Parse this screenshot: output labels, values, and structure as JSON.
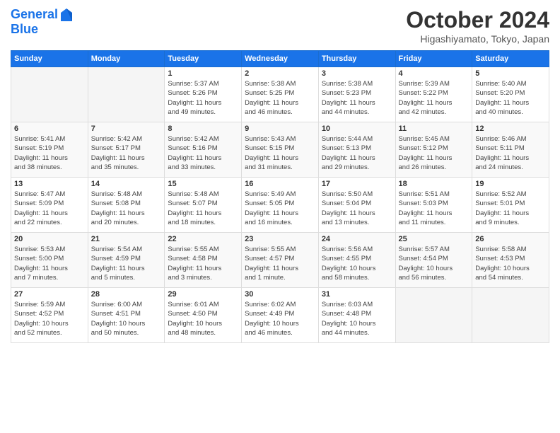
{
  "header": {
    "logo_line1": "General",
    "logo_line2": "Blue",
    "month": "October 2024",
    "location": "Higashiyamato, Tokyo, Japan"
  },
  "days_of_week": [
    "Sunday",
    "Monday",
    "Tuesday",
    "Wednesday",
    "Thursday",
    "Friday",
    "Saturday"
  ],
  "weeks": [
    [
      {
        "num": "",
        "detail": ""
      },
      {
        "num": "",
        "detail": ""
      },
      {
        "num": "1",
        "detail": "Sunrise: 5:37 AM\nSunset: 5:26 PM\nDaylight: 11 hours\nand 49 minutes."
      },
      {
        "num": "2",
        "detail": "Sunrise: 5:38 AM\nSunset: 5:25 PM\nDaylight: 11 hours\nand 46 minutes."
      },
      {
        "num": "3",
        "detail": "Sunrise: 5:38 AM\nSunset: 5:23 PM\nDaylight: 11 hours\nand 44 minutes."
      },
      {
        "num": "4",
        "detail": "Sunrise: 5:39 AM\nSunset: 5:22 PM\nDaylight: 11 hours\nand 42 minutes."
      },
      {
        "num": "5",
        "detail": "Sunrise: 5:40 AM\nSunset: 5:20 PM\nDaylight: 11 hours\nand 40 minutes."
      }
    ],
    [
      {
        "num": "6",
        "detail": "Sunrise: 5:41 AM\nSunset: 5:19 PM\nDaylight: 11 hours\nand 38 minutes."
      },
      {
        "num": "7",
        "detail": "Sunrise: 5:42 AM\nSunset: 5:17 PM\nDaylight: 11 hours\nand 35 minutes."
      },
      {
        "num": "8",
        "detail": "Sunrise: 5:42 AM\nSunset: 5:16 PM\nDaylight: 11 hours\nand 33 minutes."
      },
      {
        "num": "9",
        "detail": "Sunrise: 5:43 AM\nSunset: 5:15 PM\nDaylight: 11 hours\nand 31 minutes."
      },
      {
        "num": "10",
        "detail": "Sunrise: 5:44 AM\nSunset: 5:13 PM\nDaylight: 11 hours\nand 29 minutes."
      },
      {
        "num": "11",
        "detail": "Sunrise: 5:45 AM\nSunset: 5:12 PM\nDaylight: 11 hours\nand 26 minutes."
      },
      {
        "num": "12",
        "detail": "Sunrise: 5:46 AM\nSunset: 5:11 PM\nDaylight: 11 hours\nand 24 minutes."
      }
    ],
    [
      {
        "num": "13",
        "detail": "Sunrise: 5:47 AM\nSunset: 5:09 PM\nDaylight: 11 hours\nand 22 minutes."
      },
      {
        "num": "14",
        "detail": "Sunrise: 5:48 AM\nSunset: 5:08 PM\nDaylight: 11 hours\nand 20 minutes."
      },
      {
        "num": "15",
        "detail": "Sunrise: 5:48 AM\nSunset: 5:07 PM\nDaylight: 11 hours\nand 18 minutes."
      },
      {
        "num": "16",
        "detail": "Sunrise: 5:49 AM\nSunset: 5:05 PM\nDaylight: 11 hours\nand 16 minutes."
      },
      {
        "num": "17",
        "detail": "Sunrise: 5:50 AM\nSunset: 5:04 PM\nDaylight: 11 hours\nand 13 minutes."
      },
      {
        "num": "18",
        "detail": "Sunrise: 5:51 AM\nSunset: 5:03 PM\nDaylight: 11 hours\nand 11 minutes."
      },
      {
        "num": "19",
        "detail": "Sunrise: 5:52 AM\nSunset: 5:01 PM\nDaylight: 11 hours\nand 9 minutes."
      }
    ],
    [
      {
        "num": "20",
        "detail": "Sunrise: 5:53 AM\nSunset: 5:00 PM\nDaylight: 11 hours\nand 7 minutes."
      },
      {
        "num": "21",
        "detail": "Sunrise: 5:54 AM\nSunset: 4:59 PM\nDaylight: 11 hours\nand 5 minutes."
      },
      {
        "num": "22",
        "detail": "Sunrise: 5:55 AM\nSunset: 4:58 PM\nDaylight: 11 hours\nand 3 minutes."
      },
      {
        "num": "23",
        "detail": "Sunrise: 5:55 AM\nSunset: 4:57 PM\nDaylight: 11 hours\nand 1 minute."
      },
      {
        "num": "24",
        "detail": "Sunrise: 5:56 AM\nSunset: 4:55 PM\nDaylight: 10 hours\nand 58 minutes."
      },
      {
        "num": "25",
        "detail": "Sunrise: 5:57 AM\nSunset: 4:54 PM\nDaylight: 10 hours\nand 56 minutes."
      },
      {
        "num": "26",
        "detail": "Sunrise: 5:58 AM\nSunset: 4:53 PM\nDaylight: 10 hours\nand 54 minutes."
      }
    ],
    [
      {
        "num": "27",
        "detail": "Sunrise: 5:59 AM\nSunset: 4:52 PM\nDaylight: 10 hours\nand 52 minutes."
      },
      {
        "num": "28",
        "detail": "Sunrise: 6:00 AM\nSunset: 4:51 PM\nDaylight: 10 hours\nand 50 minutes."
      },
      {
        "num": "29",
        "detail": "Sunrise: 6:01 AM\nSunset: 4:50 PM\nDaylight: 10 hours\nand 48 minutes."
      },
      {
        "num": "30",
        "detail": "Sunrise: 6:02 AM\nSunset: 4:49 PM\nDaylight: 10 hours\nand 46 minutes."
      },
      {
        "num": "31",
        "detail": "Sunrise: 6:03 AM\nSunset: 4:48 PM\nDaylight: 10 hours\nand 44 minutes."
      },
      {
        "num": "",
        "detail": ""
      },
      {
        "num": "",
        "detail": ""
      }
    ]
  ]
}
